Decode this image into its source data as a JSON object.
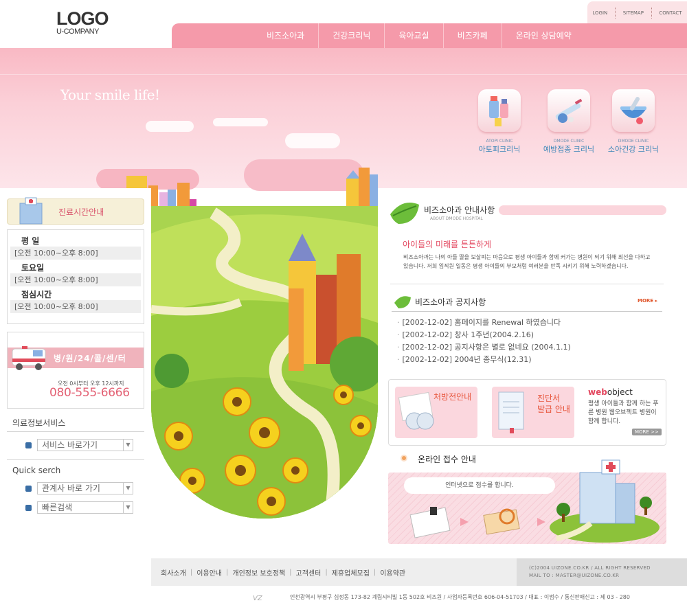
{
  "logo": {
    "line1": "LOGO",
    "line2": "U-COMPANY"
  },
  "util_nav": [
    "LOGIN",
    "SITEMAP",
    "CONTACT"
  ],
  "main_nav": [
    "비즈소아과",
    "건강크리닉",
    "육아교실",
    "비즈카페",
    "온라인 상담예약"
  ],
  "hero": {
    "tagline": "Your smile life!",
    "clinics": [
      {
        "en": "ATOPI CLINIC",
        "ko": "아토피크리닉",
        "icon": "medicine-bottles-icon"
      },
      {
        "en": "DMODE CLINIC",
        "ko": "예방접종 크리닉",
        "icon": "syringe-icon"
      },
      {
        "en": "DMODE CLINIC",
        "ko": "소아건강 크리닉",
        "icon": "mortar-bowl-icon"
      }
    ]
  },
  "hours": {
    "title": "진료시간안내",
    "rows": [
      {
        "label": "평  일",
        "value": "[오전 10:00~오후 8:00]"
      },
      {
        "label": "토요일",
        "value": "[오전 10:00~오후 8:00]"
      },
      {
        "label": "점심시간",
        "value": "[오전 10:00~오후 8:00]"
      }
    ]
  },
  "emergency": {
    "title": "병/원/24/콜/센/터",
    "hours": "오전 0시부터 오후 12시까지",
    "phone": "080-555-6666"
  },
  "info_service": {
    "title": "의료정보서비스",
    "select": "서비스 바로가기"
  },
  "quick_search": {
    "title": "Quick serch",
    "select1": "관계사 바로 가기",
    "select2": "빠른검색"
  },
  "about": {
    "title": "비즈소아과 안내사항",
    "subtitle": "ABOUT DMODE HOSPITAL",
    "headline": "아이들의 미래를 튼튼하게",
    "text": "비즈소아과는 나의 아들 딸을 보살피는 마음으로 평생 아이들과 함께 커가는 병원이 되기 위해 최선을 다하고 있습니다. 저희 임직원 일동은 평생 아이들의 부모처럼 여러분을 만족 시키기 위해 노력하겠습니다."
  },
  "notice": {
    "title": "비즈소아과 공지사항",
    "more": "MORE",
    "items": [
      "[2002-12-02] 홈페이지를 Renewal 하였습니다",
      "[2002-12-02] 창사 1주년(2004.2.16)",
      "[2002-12-02] 공지사항은 별로 없네요 (2004.1.1)",
      "[2002-12-02] 2004년 종무식(12.31)"
    ]
  },
  "services": {
    "prescription": "처방전안내",
    "diagnosis_line1": "진단서",
    "diagnosis_line2": "발급 안내",
    "web_brand_a": "web",
    "web_brand_b": "object",
    "web_text": "평생 아이들과 함께 하는 푸른 병원 웹오브젝트 병원이 함께 합니다.",
    "web_more": "MORE >>"
  },
  "online": {
    "title": "온라인 접수 안내",
    "bubble": "인터넷으로 접수를 합니다."
  },
  "footer": {
    "links": [
      "회사소개",
      "이용안내",
      "개인정보 보호정책",
      "고객센터",
      "제휴업체모집",
      "이용약관"
    ],
    "copy1": "(C)2004 UIZONE.CO.KR / ALL RIGHT RESERVED",
    "copy2": "MAIL TO : MASTER@UIZONE.CO.KR",
    "address": "인천광역시 부평구 십정동 173-82 계림시티빌 1동 502호 비즈원 / 사업자등록번호 606-04-51703 / 대표 : 이범수 / 통신판매신고 : 제 03 - 280"
  },
  "colors": {
    "pink": "#f59aaa",
    "accent": "#e3475f",
    "phone": "#e36174",
    "link_blue": "#3b86b8"
  }
}
